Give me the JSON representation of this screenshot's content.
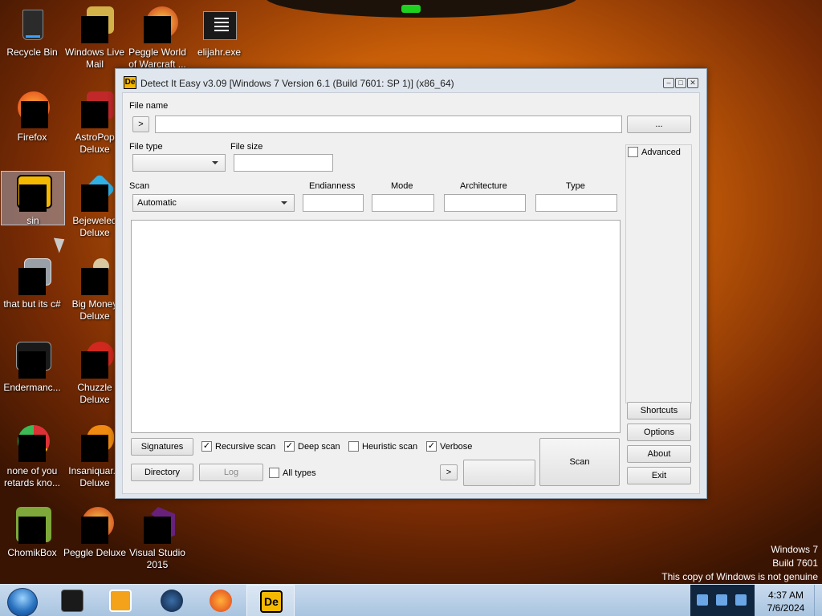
{
  "desktop": {
    "icons": [
      {
        "label": "Recycle Bin",
        "icon": "recycle-bin-icon"
      },
      {
        "label": "Windows Live Mail",
        "icon": "windows-live-mail-icon"
      },
      {
        "label": "Peggle World of Warcraft ...",
        "icon": "peggle-world-of-warcraft-icon"
      },
      {
        "label": "elijahr.exe",
        "icon": "exe-file-icon"
      },
      {
        "label": "Firefox",
        "icon": "firefox-icon"
      },
      {
        "label": "AstroPop Deluxe",
        "icon": "astropop-icon"
      },
      {
        "label": "sin",
        "icon": "detect-it-easy-icon"
      },
      {
        "label": "Bejeweled Deluxe",
        "icon": "bejeweled-icon"
      },
      {
        "label": "that but its c#",
        "icon": "folder-stack-icon"
      },
      {
        "label": "Big Money Deluxe",
        "icon": "big-money-icon"
      },
      {
        "label": "Endermanc...",
        "icon": "exe-file-icon"
      },
      {
        "label": "Chuzzle Deluxe",
        "icon": "chuzzle-icon"
      },
      {
        "label": "none of you retards kno...",
        "icon": "chrome-icon"
      },
      {
        "label": "Insaniquar... Deluxe",
        "icon": "insaniquarium-icon"
      },
      {
        "label": "ChomikBox",
        "icon": "chomikbox-icon"
      },
      {
        "label": "Peggle Deluxe",
        "icon": "peggle-icon"
      },
      {
        "label": "Visual Studio 2015",
        "icon": "visual-studio-icon"
      }
    ],
    "watermark": [
      "Windows 7",
      "Build 7601",
      "This copy of Windows is not genuine"
    ]
  },
  "window": {
    "app_icon_text": "De",
    "title": "Detect It Easy v3.09 [Windows 7 Version 6.1 (Build 7601: SP 1)] (x86_64)",
    "file_name_label": "File name",
    "file_name_value": "",
    "arrow_button": ">",
    "browse_button": "...",
    "file_type_label": "File type",
    "file_type_value": "",
    "file_size_label": "File size",
    "file_size_value": "",
    "advanced_label": "Advanced",
    "scan_label": "Scan",
    "scan_value": "Automatic",
    "endianness_label": "Endianness",
    "mode_label": "Mode",
    "architecture_label": "Architecture",
    "type_label": "Type",
    "signatures_button": "Signatures",
    "directory_button": "Directory",
    "log_button": "Log",
    "recursive_scan": {
      "label": "Recursive scan",
      "checked": true
    },
    "deep_scan": {
      "label": "Deep scan",
      "checked": true
    },
    "heuristic_scan": {
      "label": "Heuristic scan",
      "checked": false
    },
    "verbose": {
      "label": "Verbose",
      "checked": true
    },
    "all_types": {
      "label": "All types",
      "checked": false
    },
    "next_button": ">",
    "scan_button": "Scan",
    "shortcuts_button": "Shortcuts",
    "options_button": "Options",
    "about_button": "About",
    "exit_button": "Exit",
    "check_mark": "✓"
  },
  "taskbar": {
    "time": "4:37 AM",
    "date": "7/6/2024",
    "active_app_text": "De"
  }
}
